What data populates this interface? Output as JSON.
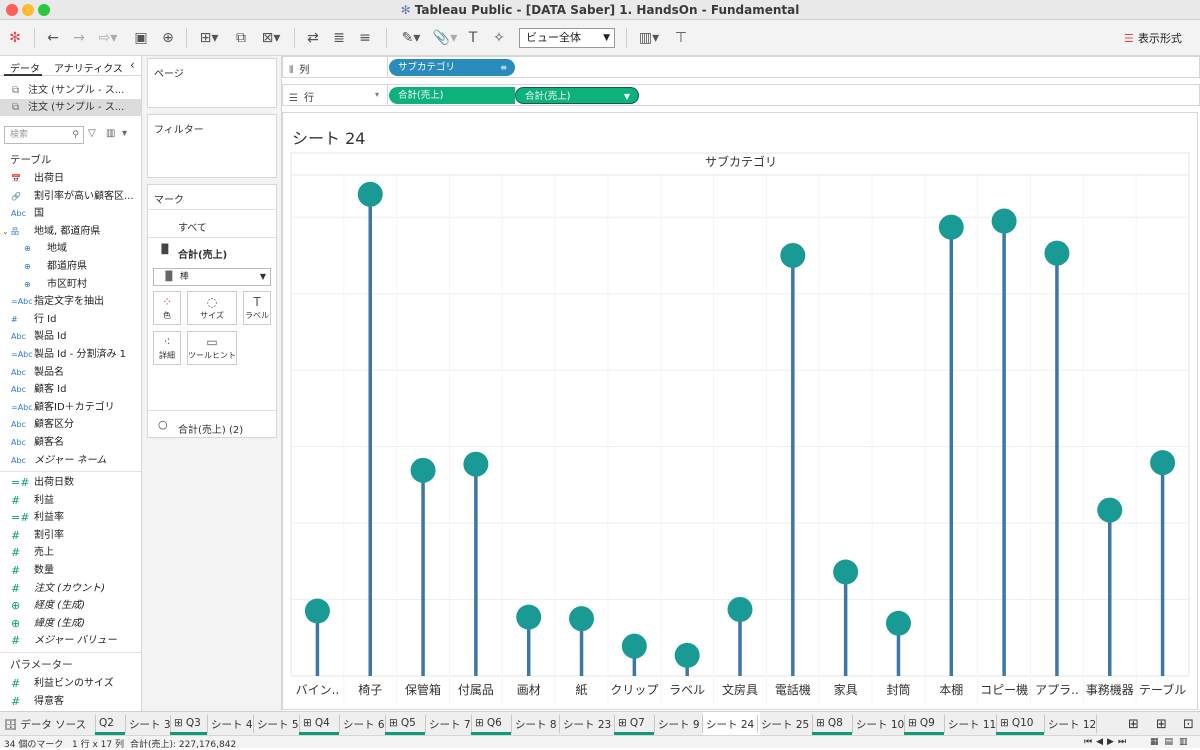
{
  "window": {
    "title": "Tableau Public - [DATA Saber] 1. HandsOn - Fundamental"
  },
  "toolbar": {
    "view_select": "ビュー全体",
    "show_me": "表示形式"
  },
  "data_pane": {
    "tabs": [
      "データ",
      "アナリティクス"
    ],
    "datasources": [
      "注文 (サンプル - ス...",
      "注文 (サンプル - ス..."
    ],
    "search_placeholder": "検索",
    "tables_header": "テーブル",
    "dimensions": [
      {
        "icon": "📅",
        "label": "出荷日"
      },
      {
        "icon": "🔗",
        "label": "割引率が高い顧客区..."
      },
      {
        "icon": "Abc",
        "label": "国"
      },
      {
        "icon": "品",
        "label": "地域, 都道府県"
      },
      {
        "icon": "⊕",
        "label": "地域",
        "sub": true
      },
      {
        "icon": "⊕",
        "label": "都道府県",
        "sub": true
      },
      {
        "icon": "⊕",
        "label": "市区町村",
        "sub": true
      },
      {
        "icon": "=Abc",
        "label": "指定文字を抽出"
      },
      {
        "icon": "#",
        "label": "行 Id"
      },
      {
        "icon": "Abc",
        "label": "製品 Id"
      },
      {
        "icon": "=Abc",
        "label": "製品 Id - 分割済み 1"
      },
      {
        "icon": "Abc",
        "label": "製品名"
      },
      {
        "icon": "Abc",
        "label": "顧客 Id"
      },
      {
        "icon": "=Abc",
        "label": "顧客ID＋カテゴリ"
      },
      {
        "icon": "Abc",
        "label": "顧客区分"
      },
      {
        "icon": "Abc",
        "label": "顧客名"
      },
      {
        "icon": "Abc",
        "label": "メジャー ネーム",
        "italic": true
      }
    ],
    "measures": [
      {
        "icon": "=#",
        "label": "出荷日数"
      },
      {
        "icon": "#",
        "label": "利益"
      },
      {
        "icon": "=#",
        "label": "利益率"
      },
      {
        "icon": "#",
        "label": "割引率"
      },
      {
        "icon": "#",
        "label": "売上"
      },
      {
        "icon": "#",
        "label": "数量"
      },
      {
        "icon": "#",
        "label": "注文 (カウント)",
        "italic": true
      },
      {
        "icon": "⊕",
        "label": "経度 (生成)",
        "italic": true
      },
      {
        "icon": "⊕",
        "label": "緯度 (生成)",
        "italic": true
      },
      {
        "icon": "#",
        "label": "メジャー バリュー",
        "italic": true
      }
    ],
    "params_header": "パラメーター",
    "params": [
      {
        "icon": "#",
        "label": "利益ビンのサイズ"
      },
      {
        "icon": "#",
        "label": "得意客"
      }
    ]
  },
  "cards": {
    "pages": "ページ",
    "filters": "フィルター",
    "marks": "マーク",
    "marks_all": "すべて",
    "marks_sum1": "合計(売上)",
    "mark_type": "棒",
    "buttons": {
      "color": "色",
      "size": "サイズ",
      "label": "ラベル",
      "detail": "詳細",
      "tooltip": "ツールヒント"
    },
    "marks_sum2": "合計(売上) (2)"
  },
  "shelves": {
    "columns_label": "列",
    "rows_label": "行",
    "columns_pill": "サブカテゴリ",
    "rows_pill1": "合計(売上)",
    "rows_pill2": "合計(売上)"
  },
  "sheet": {
    "title": "シート 24"
  },
  "chart_data": {
    "type": "lollipop",
    "header": "サブカテゴリ",
    "categories": [
      "バイン..",
      "椅子",
      "保管箱",
      "付属品",
      "画材",
      "紙",
      "クリップ",
      "ラベル",
      "文房具",
      "電話機",
      "家具",
      "封筒",
      "本棚",
      "コピー機",
      "アプラ..",
      "事務機器",
      "テーブル"
    ],
    "values": [
      8.5,
      63.0,
      26.9,
      27.7,
      7.7,
      7.5,
      3.9,
      2.7,
      8.7,
      55.0,
      13.6,
      6.9,
      58.7,
      59.5,
      55.3,
      21.7,
      27.9
    ],
    "ylim": [
      0,
      65
    ],
    "color_stem": "#3b77a8",
    "color_dot": "#1a9a94",
    "grid": true
  },
  "sheet_tabs": [
    {
      "label": "データ ソース",
      "icon": "🗄"
    },
    {
      "label": "Q2",
      "green": true
    },
    {
      "label": "シート 3"
    },
    {
      "label": "Q3",
      "icon": "⊞",
      "green": true
    },
    {
      "label": "シート 4"
    },
    {
      "label": "シート 5"
    },
    {
      "label": "Q4",
      "icon": "⊞",
      "green": true
    },
    {
      "label": "シート 6"
    },
    {
      "label": "Q5",
      "icon": "⊞",
      "green": true
    },
    {
      "label": "シート 7"
    },
    {
      "label": "Q6",
      "icon": "⊞",
      "green": true
    },
    {
      "label": "シート 8"
    },
    {
      "label": "シート 23"
    },
    {
      "label": "Q7",
      "icon": "⊞",
      "green": true
    },
    {
      "label": "シート 9"
    },
    {
      "label": "シート 24",
      "active": true
    },
    {
      "label": "シート 25"
    },
    {
      "label": "Q8",
      "icon": "⊞",
      "green": true
    },
    {
      "label": "シート 10"
    },
    {
      "label": "Q9",
      "icon": "⊞",
      "green": true
    },
    {
      "label": "シート 11"
    },
    {
      "label": "Q10",
      "icon": "⊞",
      "green": true
    },
    {
      "label": "シート 12"
    }
  ],
  "status": {
    "marks": "34 個のマーク",
    "rows_cols": "1 行 x 17 列",
    "sum": "合計(売上): 227,176,842"
  },
  "colors": {
    "pill_blue": "#2a8bbd",
    "pill_green": "#0db27a",
    "tab_green": "#0f9b78"
  }
}
